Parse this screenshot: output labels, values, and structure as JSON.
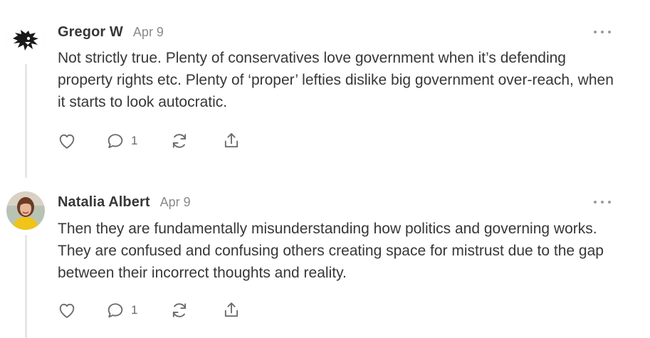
{
  "comments": [
    {
      "author": "Gregor W",
      "date": "Apr 9",
      "avatar_icon": "wolf-silhouette-icon",
      "body": "Not strictly true. Plenty of conservatives love government when it’s defending property rights etc. Plenty of ‘proper’ lefties dislike big government over-reach, when it starts to look autocratic.",
      "reply_count": "1"
    },
    {
      "author": "Natalia Albert",
      "date": "Apr 9",
      "avatar_icon": "profile-photo",
      "body": "Then they are fundamentally misunderstanding how politics and governing works. They are confused and confusing others creating space for mistrust due to the gap between their incorrect thoughts and reality.",
      "reply_count": "1"
    }
  ],
  "icons": {
    "like": "heart-icon",
    "reply": "speech-bubble-icon",
    "restack": "refresh-icon",
    "share": "share-icon",
    "more": "ellipsis-icon"
  },
  "colors": {
    "text": "#363737",
    "muted": "#8a8a8a",
    "icon": "#6b6b6b",
    "thread_line": "#e6e6e6"
  }
}
